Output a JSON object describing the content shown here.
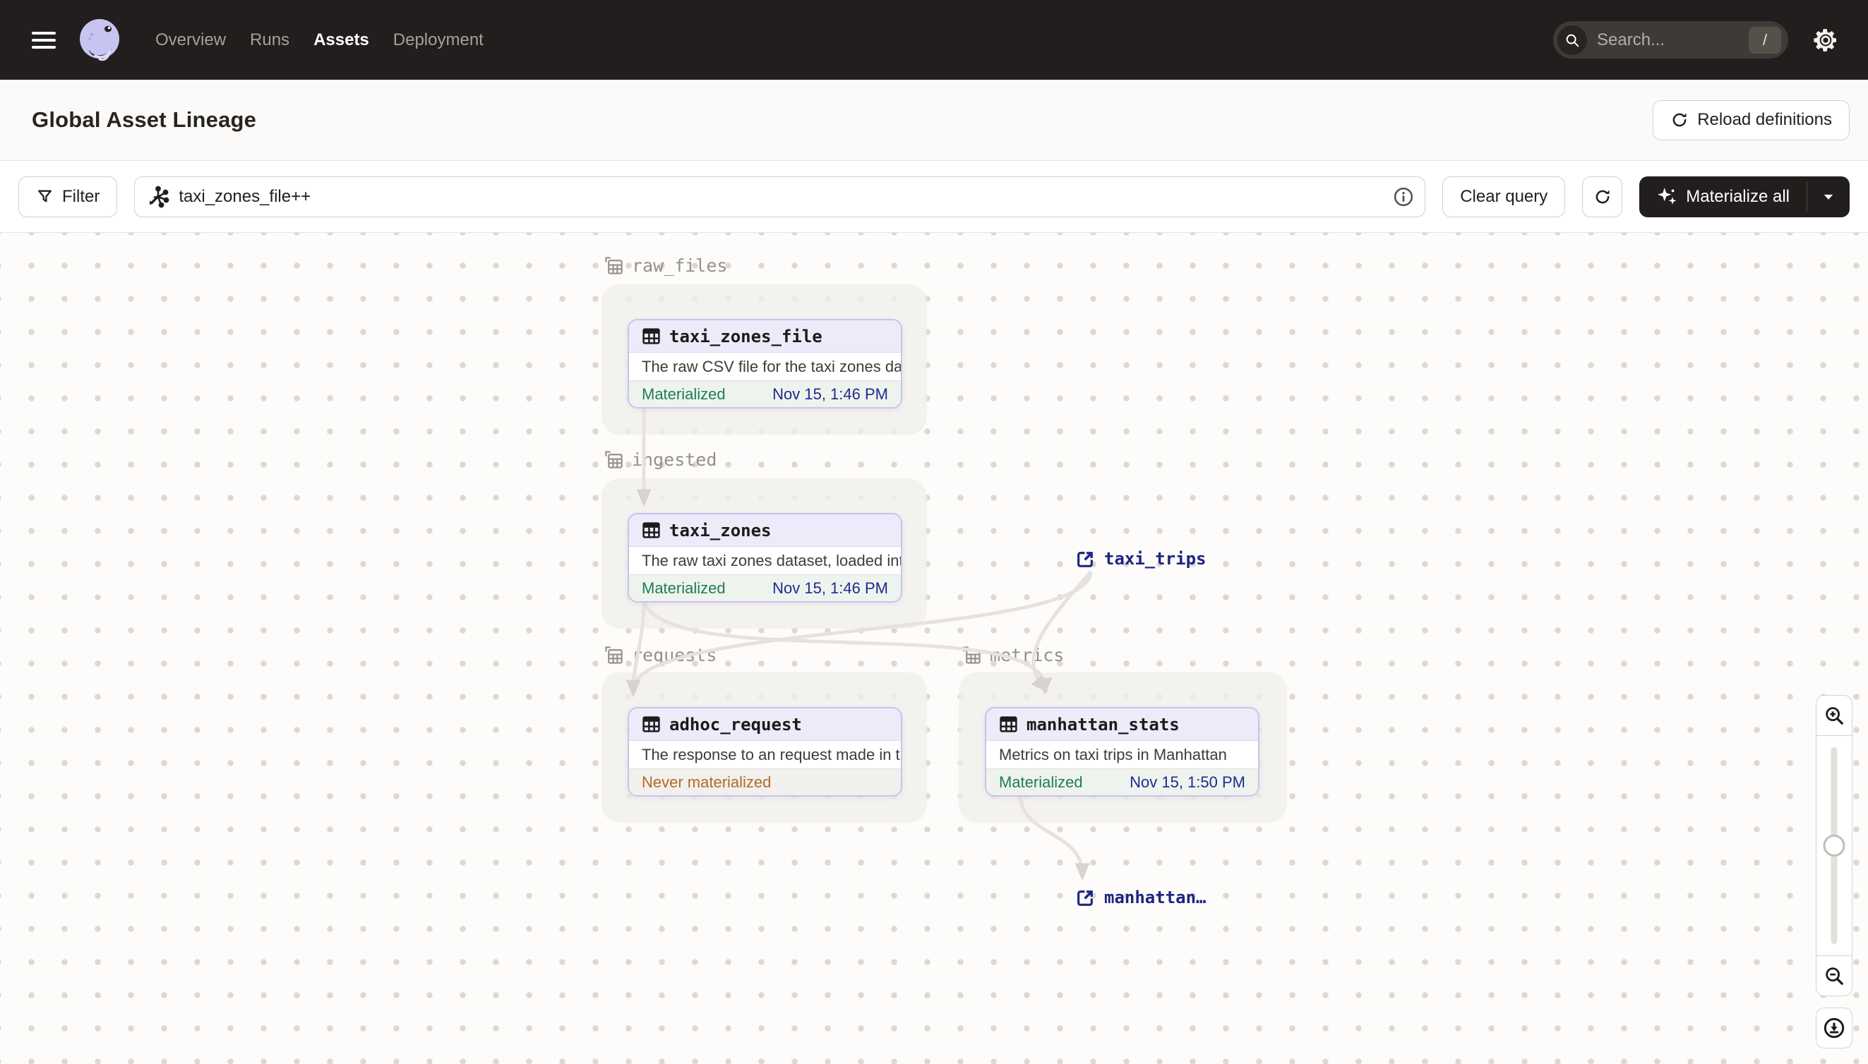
{
  "nav": {
    "items": [
      {
        "label": "Overview",
        "active": false
      },
      {
        "label": "Runs",
        "active": false
      },
      {
        "label": "Assets",
        "active": true
      },
      {
        "label": "Deployment",
        "active": false
      }
    ],
    "search": {
      "placeholder": "Search...",
      "shortcut": "/"
    }
  },
  "header": {
    "title": "Global Asset Lineage",
    "reload_label": "Reload definitions"
  },
  "toolbar": {
    "filter_label": "Filter",
    "query_value": "taxi_zones_file++",
    "clear_query_label": "Clear query",
    "materialize_label": "Materialize all"
  },
  "graph": {
    "groups": [
      {
        "label": "raw_files"
      },
      {
        "label": "ingested"
      },
      {
        "label": "requests"
      },
      {
        "label": "metrics"
      }
    ],
    "nodes": [
      {
        "name": "taxi_zones_file",
        "description": "The raw CSV file for the taxi zones dat…",
        "status": "Materialized",
        "timestamp": "Nov 15, 1:46 PM"
      },
      {
        "name": "taxi_zones",
        "description": "The raw taxi zones dataset, loaded int…",
        "status": "Materialized",
        "timestamp": "Nov 15, 1:46 PM"
      },
      {
        "name": "adhoc_request",
        "description": "The response to an request made in th…",
        "status": "Never materialized",
        "timestamp": ""
      },
      {
        "name": "manhattan_stats",
        "description": "Metrics on taxi trips in Manhattan",
        "status": "Materialized",
        "timestamp": "Nov 15, 1:50 PM"
      }
    ],
    "external_links": [
      {
        "label": "taxi_trips"
      },
      {
        "label": "manhattan…"
      }
    ]
  },
  "icons": [
    "hamburger-icon",
    "dagster-logo",
    "search-icon",
    "slash-shortcut",
    "gear-icon",
    "reload-icon",
    "filter-icon",
    "graph-query-icon",
    "info-icon",
    "refresh-icon",
    "sparkle-icon",
    "caret-down-icon",
    "group-icon",
    "table-icon",
    "external-link-icon",
    "zoom-in-icon",
    "zoom-out-icon",
    "download-icon"
  ],
  "colors": {
    "nav_bg": "#211e1d",
    "accent_purple": "#c9c3ef",
    "node_header": "#edeafa",
    "materialized_green": "#1e7d52",
    "never_materialized_orange": "#b06a28",
    "link_navy": "#1d2680",
    "timestamp_navy": "#1f2b8e"
  }
}
